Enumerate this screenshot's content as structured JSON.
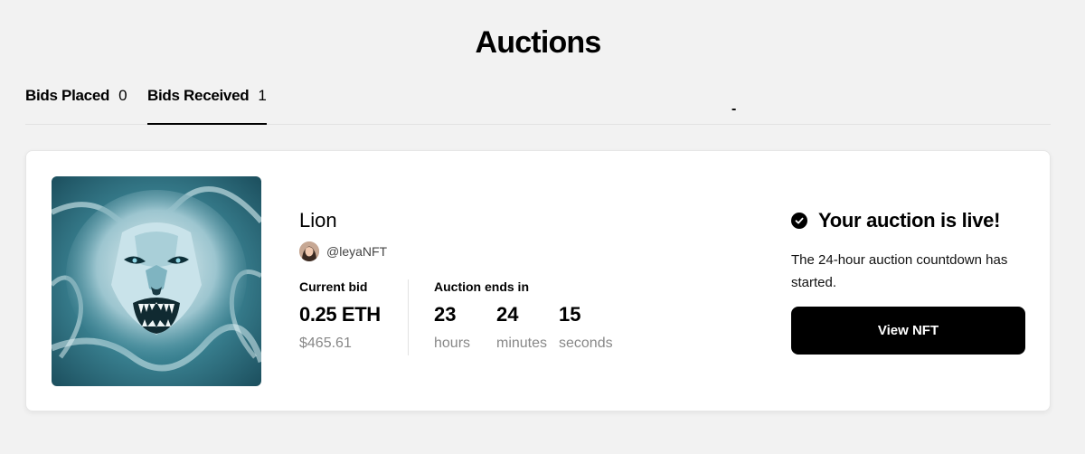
{
  "page": {
    "title": "Auctions"
  },
  "tabs": [
    {
      "label": "Bids Placed",
      "count": "0",
      "active": false
    },
    {
      "label": "Bids Received",
      "count": "1",
      "active": true
    }
  ],
  "separator": "-",
  "auction": {
    "image_icon": "lion-artwork",
    "name": "Lion",
    "creator": {
      "handle": "@leyaNFT",
      "avatar_icon": "creator-avatar"
    },
    "current_bid": {
      "label": "Current bid",
      "eth": "0.25 ETH",
      "usd": "$465.61"
    },
    "countdown": {
      "label": "Auction ends in",
      "hours": {
        "value": "23",
        "unit": "hours"
      },
      "minutes": {
        "value": "24",
        "unit": "minutes"
      },
      "seconds": {
        "value": "15",
        "unit": "seconds"
      }
    },
    "status": {
      "icon": "check-circle-icon",
      "title": "Your auction is live!",
      "description": "The 24-hour auction countdown has started.",
      "button_label": "View NFT"
    }
  },
  "colors": {
    "background": "#f2f2f2",
    "card": "#ffffff",
    "accent": "#000000",
    "muted": "#888888"
  }
}
